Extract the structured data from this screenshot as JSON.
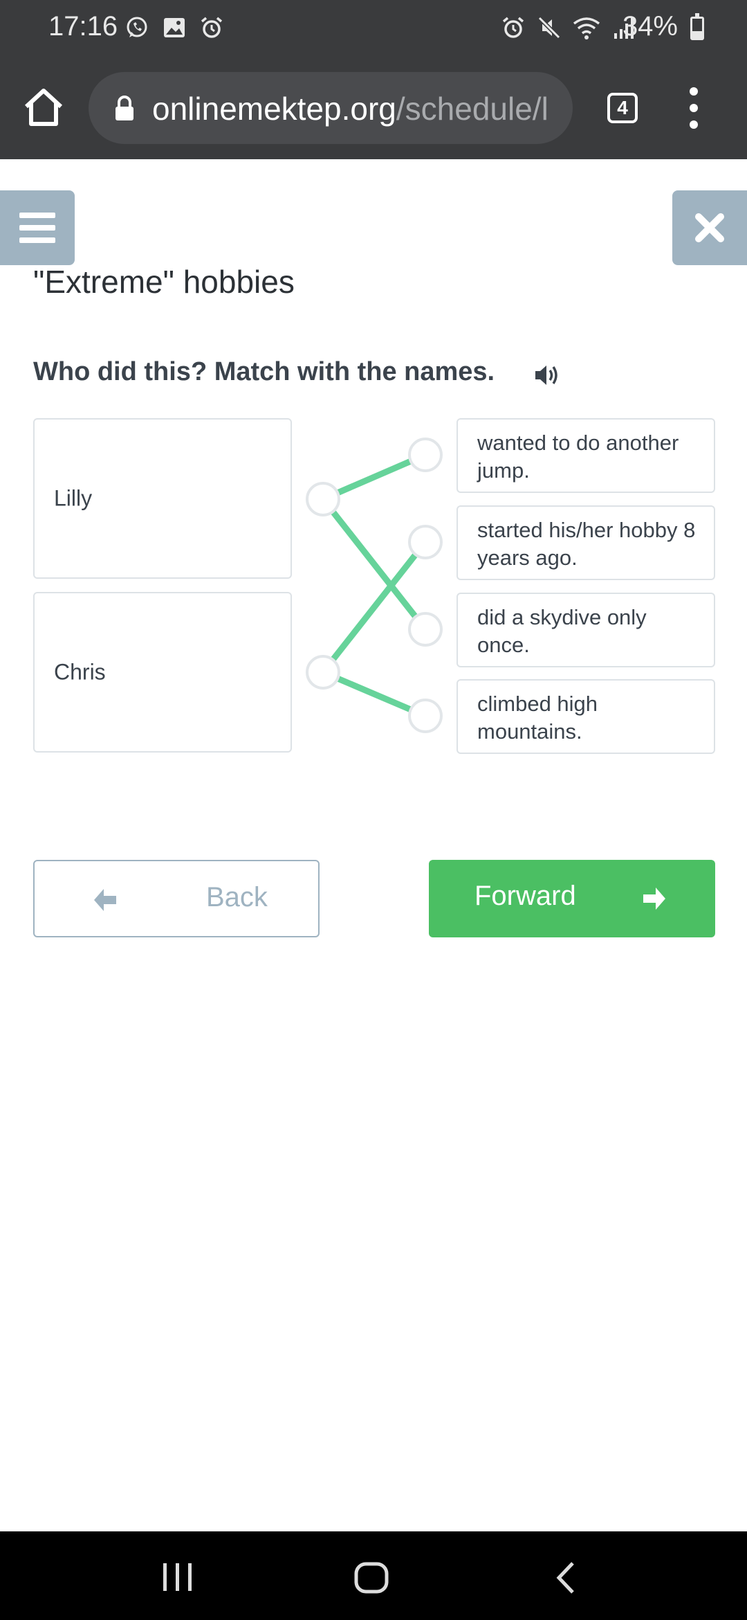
{
  "status_bar": {
    "time": "17:16",
    "battery": "34%",
    "battery_level": 0.34,
    "left_icons": [
      "whatsapp-icon",
      "gallery-icon",
      "alarm-icon"
    ],
    "right_icons": [
      "alarm-icon",
      "mute-icon",
      "wifi-icon",
      "signal-icon",
      "battery-icon"
    ]
  },
  "browser": {
    "url_domain": "onlinemektep.org",
    "url_path": "/schedule/l",
    "tab_count": "4"
  },
  "page": {
    "title": "\"Extreme\" hobbies",
    "instruction": "Who did this? Match with the names."
  },
  "names": [
    {
      "label": "Lilly"
    },
    {
      "label": "Chris"
    }
  ],
  "options": [
    {
      "label": "wanted to do another jump."
    },
    {
      "label": "started his/her hobby 8 years ago."
    },
    {
      "label": "did a skydive only once."
    },
    {
      "label": "climbed high mountains."
    }
  ],
  "matches": [
    {
      "name": 0,
      "option": 0
    },
    {
      "name": 0,
      "option": 2
    },
    {
      "name": 1,
      "option": 1
    },
    {
      "name": 1,
      "option": 3
    }
  ],
  "buttons": {
    "back": "Back",
    "forward": "Forward"
  },
  "colors": {
    "accent_green": "#4bbf63",
    "match_line": "#66d39a",
    "muted_blue": "#9fb3c1",
    "chrome_dark": "#3a3b3d"
  }
}
